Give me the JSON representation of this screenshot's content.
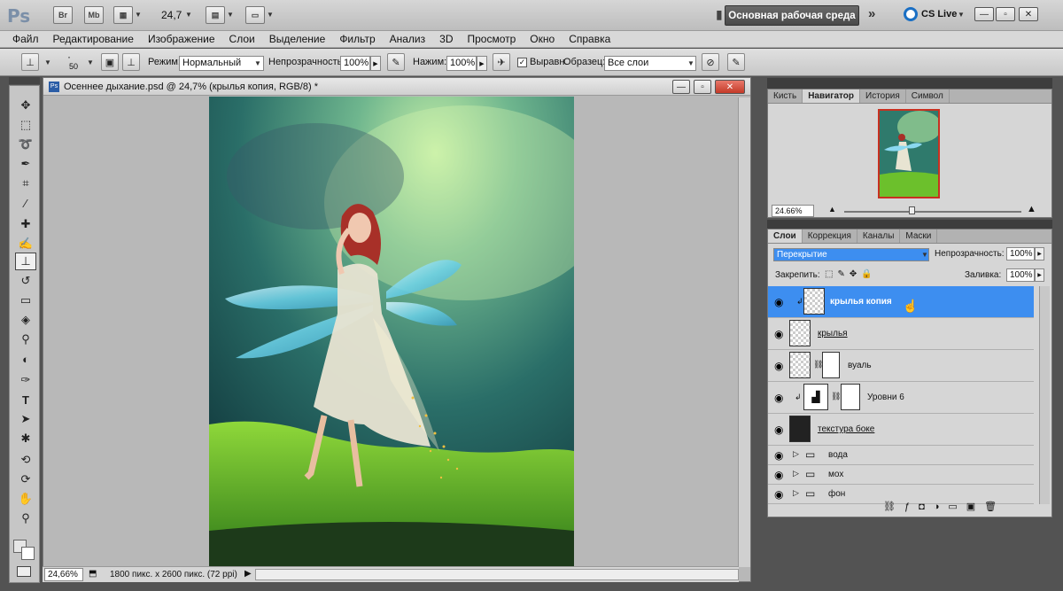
{
  "app": {
    "logo": "Ps",
    "bridge_label": "Br",
    "minibridge_label": "Mb",
    "zoom_display": "24,7",
    "workspace_label": "Основная рабочая среда",
    "cs_live_label": "CS Live"
  },
  "menu": [
    "Файл",
    "Редактирование",
    "Изображение",
    "Слои",
    "Выделение",
    "Фильтр",
    "Анализ",
    "3D",
    "Просмотр",
    "Окно",
    "Справка"
  ],
  "options": {
    "brush_size": "50",
    "mode_label": "Режим:",
    "mode_value": "Нормальный",
    "opacity_label": "Непрозрачность:",
    "opacity_value": "100%",
    "flow_label": "Нажим:",
    "flow_value": "100%",
    "aligned_label": "Выравн.",
    "sample_label": "Образец:",
    "sample_value": "Все слои"
  },
  "document": {
    "title": "Осеннее дыхание.psd @ 24,7% (крылья копия, RGB/8) *",
    "zoom": "24,66%",
    "info": "1800 пикс. x 2600 пикс. (72 ppi)"
  },
  "navigator_panel": {
    "tabs": [
      "Кисть",
      "Навигатор",
      "История",
      "Символ"
    ],
    "active_tab": "Навигатор",
    "zoom": "24.66%"
  },
  "layers_panel": {
    "tabs": [
      "Слои",
      "Коррекция",
      "Каналы",
      "Маски"
    ],
    "active_tab": "Слои",
    "blend_mode": "Перекрытие",
    "opacity_label": "Непрозрачность:",
    "opacity_value": "100%",
    "lock_label": "Закрепить:",
    "fill_label": "Заливка:",
    "fill_value": "100%",
    "layers": [
      {
        "name": "крылья копия",
        "selected": true
      },
      {
        "name": "крылья",
        "selected": false
      },
      {
        "name": "вуаль",
        "selected": false
      },
      {
        "name": "Уровни 6",
        "selected": false
      },
      {
        "name": "текстура боке",
        "selected": false
      },
      {
        "name": "вода",
        "selected": false
      },
      {
        "name": "мох",
        "selected": false
      },
      {
        "name": "фон",
        "selected": false
      }
    ]
  },
  "colors": {
    "selection": "#3d8ef0",
    "app_bg": "#535353"
  }
}
